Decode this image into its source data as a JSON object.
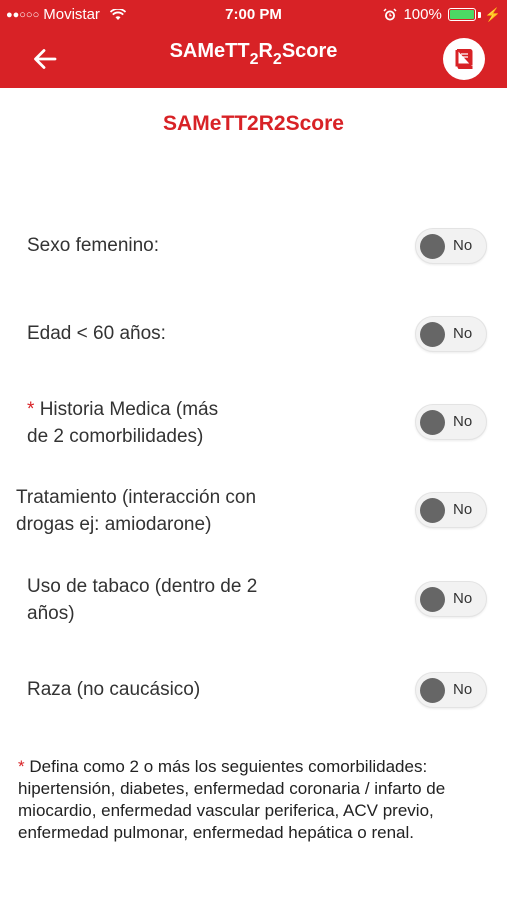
{
  "status_bar": {
    "carrier": "Movistar",
    "signal_dots": "●●○○○",
    "time": "7:00 PM",
    "battery": "100%"
  },
  "header": {
    "title_main": "SAMeTT",
    "title_sub1": "2",
    "title_mid": "R",
    "title_sub2": "2",
    "title_end": "Score"
  },
  "main": {
    "title": "SAMeTT2R2Score",
    "questions": [
      {
        "label": "Sexo femenino:",
        "value": "No"
      },
      {
        "label": "Edad < 60 años:",
        "value": "No"
      },
      {
        "asterisk": "*",
        "label_line1": "Historia Medica (más",
        "label_line2": "de 2 comorbilidades)",
        "value": "No"
      },
      {
        "label_line1": "Tratamiento (interacción con",
        "label_line2": "drogas ej: amiodarone)",
        "value": "No"
      },
      {
        "label_line1": "Uso de tabaco (dentro de 2",
        "label_line2": "años)",
        "value": "No"
      },
      {
        "label": "Raza (no caucásico)",
        "value": "No"
      }
    ],
    "footnote": {
      "asterisk": "*",
      "text": "Defina como 2 o más los seguientes comorbilidades: hipertensión, diabetes, enfermedad coronaria / infarto de miocardio, enfermedad vascular periferica, ACV previo, enfermedad pulmonar, enfermedad hepática o renal."
    }
  },
  "colors": {
    "brand_red": "#d82226",
    "battery_green": "#4cd964",
    "toggle_knob": "#666666"
  },
  "icons": {
    "back": "arrow-left-icon",
    "book": "book-icon",
    "wifi": "wifi-icon",
    "alarm": "alarm-icon",
    "battery": "battery-icon"
  }
}
